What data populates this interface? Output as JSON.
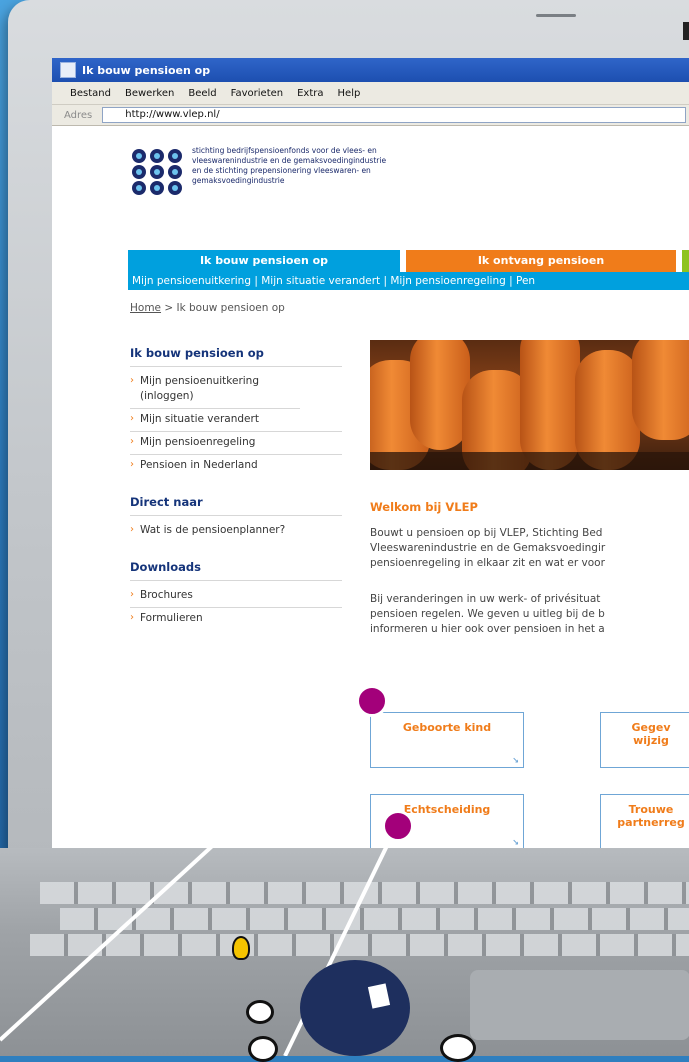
{
  "browser": {
    "title": "Ik bouw pensioen op",
    "menu": [
      "Bestand",
      "Bewerken",
      "Beeld",
      "Favorieten",
      "Extra",
      "Help"
    ],
    "address_label": "Adres",
    "url": "http://www.vlep.nl/"
  },
  "logo": {
    "line1": "stichting bedrijfspensioenfonds voor de vlees- en",
    "line2": "vleeswarenindustrie en de gemaksvoedingindustrie",
    "line3": "en de stichting prepensionering vleeswaren- en",
    "line4": "gemaksvoedingindustrie"
  },
  "tabs": [
    "Ik bouw pensioen op",
    "Ik ontvang pensioen"
  ],
  "subnav": "Mijn pensioenuitkering | Mijn situatie verandert | Mijn pensioenregeling | Pen",
  "breadcrumb": {
    "home": "Home",
    "rest": " > Ik bouw pensioen op"
  },
  "sidebar": {
    "section1": {
      "heading": "Ik bouw pensioen op",
      "items": [
        "Mijn pensioenuitkering (inloggen)",
        "Mijn situatie verandert",
        "Mijn pensioenregeling",
        "Pensioen in Nederland"
      ]
    },
    "section2": {
      "heading": "Direct naar",
      "items": [
        "Wat is de pensioenplanner?"
      ]
    },
    "section3": {
      "heading": "Downloads",
      "items": [
        "Brochures",
        "Formulieren"
      ]
    }
  },
  "main": {
    "welcome": "Welkom bij VLEP",
    "para1": [
      "Bouwt u pensioen op bij VLEP, Stichting Bed",
      "Vleeswarenindustrie en de Gemaksvoedingir",
      "pensioenregeling in elkaar zit en wat er voor"
    ],
    "para2": [
      "Bij veranderingen in uw werk- of privésituat",
      "pensioen regelen. We geven u uitleg bij de b",
      "informeren u hier ook over pensioen in het a"
    ],
    "buttons": {
      "geboorte": "Geboorte kind",
      "gegevens_1": "Gegev",
      "gegevens_2": "wijzig",
      "echtscheiding": "Echtscheiding",
      "trouwen_1": "Trouwe",
      "trouwen_2": "partnerreg"
    }
  },
  "colors": {
    "blue_tab": "#00a0de",
    "orange_tab": "#f07c1a",
    "green_tab": "#8fc31f",
    "callout": "#a3007a"
  }
}
